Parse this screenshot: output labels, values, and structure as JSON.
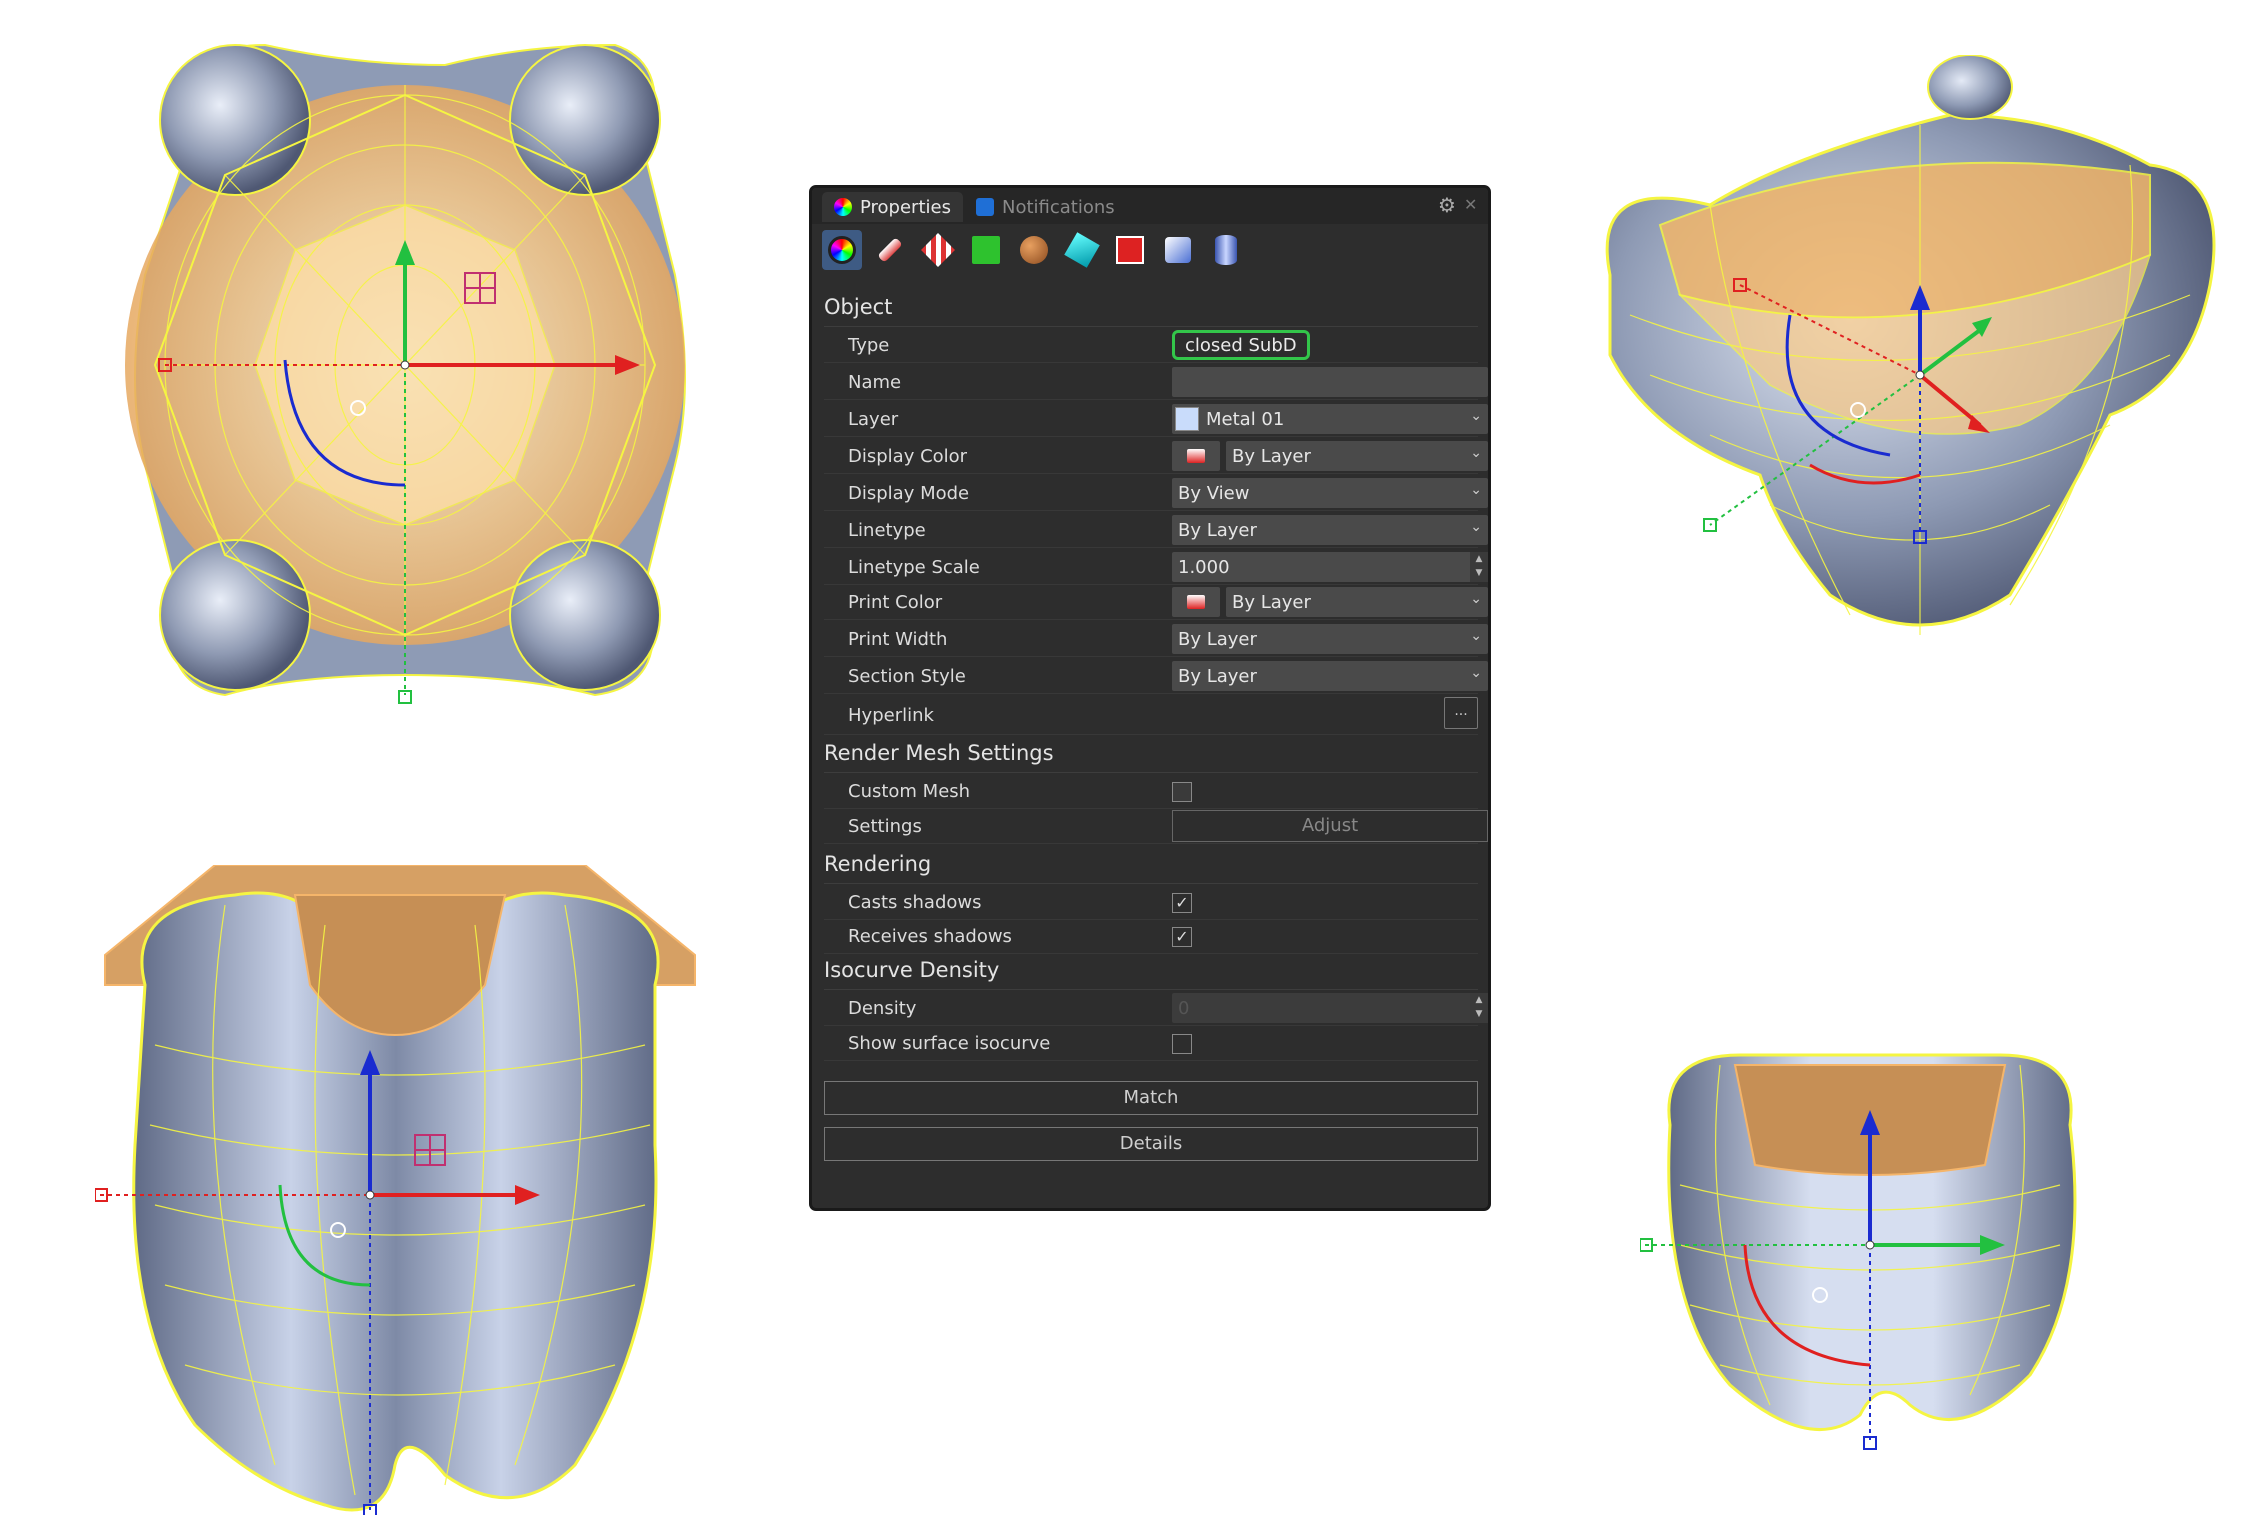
{
  "tabs": {
    "properties": "Properties",
    "notifications": "Notifications"
  },
  "toolbar_icons": [
    "object-properties-icon",
    "curve-pipe-icon",
    "decal-icon",
    "texture-mapping-icon",
    "material-icon",
    "sun-icon",
    "section-icon",
    "object-icon",
    "cylinder-icon"
  ],
  "sections": {
    "object": "Object",
    "render_mesh": "Render Mesh Settings",
    "rendering": "Rendering",
    "isocurve": "Isocurve Density"
  },
  "object": {
    "type_label": "Type",
    "type_value": "closed SubD",
    "name_label": "Name",
    "name_value": "",
    "layer_label": "Layer",
    "layer_value": "Metal 01",
    "display_color_label": "Display Color",
    "display_color_value": "By Layer",
    "display_mode_label": "Display Mode",
    "display_mode_value": "By View",
    "linetype_label": "Linetype",
    "linetype_value": "By Layer",
    "linetype_scale_label": "Linetype Scale",
    "linetype_scale_value": "1.000",
    "print_color_label": "Print Color",
    "print_color_value": "By Layer",
    "print_width_label": "Print Width",
    "print_width_value": "By Layer",
    "section_style_label": "Section Style",
    "section_style_value": "By Layer",
    "hyperlink_label": "Hyperlink",
    "hyperlink_button": "..."
  },
  "render_mesh": {
    "custom_mesh_label": "Custom Mesh",
    "custom_mesh_checked": false,
    "settings_label": "Settings",
    "adjust_button": "Adjust"
  },
  "rendering": {
    "casts_shadows_label": "Casts shadows",
    "casts_shadows_checked": true,
    "receives_shadows_label": "Receives shadows",
    "receives_shadows_checked": true
  },
  "isocurve": {
    "density_label": "Density",
    "density_value": "0",
    "show_surface_label": "Show surface isocurve",
    "show_surface_checked": false
  },
  "buttons": {
    "match": "Match",
    "details": "Details"
  },
  "colors": {
    "highlight": "#33c64a",
    "panel_bg": "#2d2d2d",
    "wire": "#f5f542",
    "mesh": "#f0b56a",
    "surface": "#8e9bb5"
  }
}
